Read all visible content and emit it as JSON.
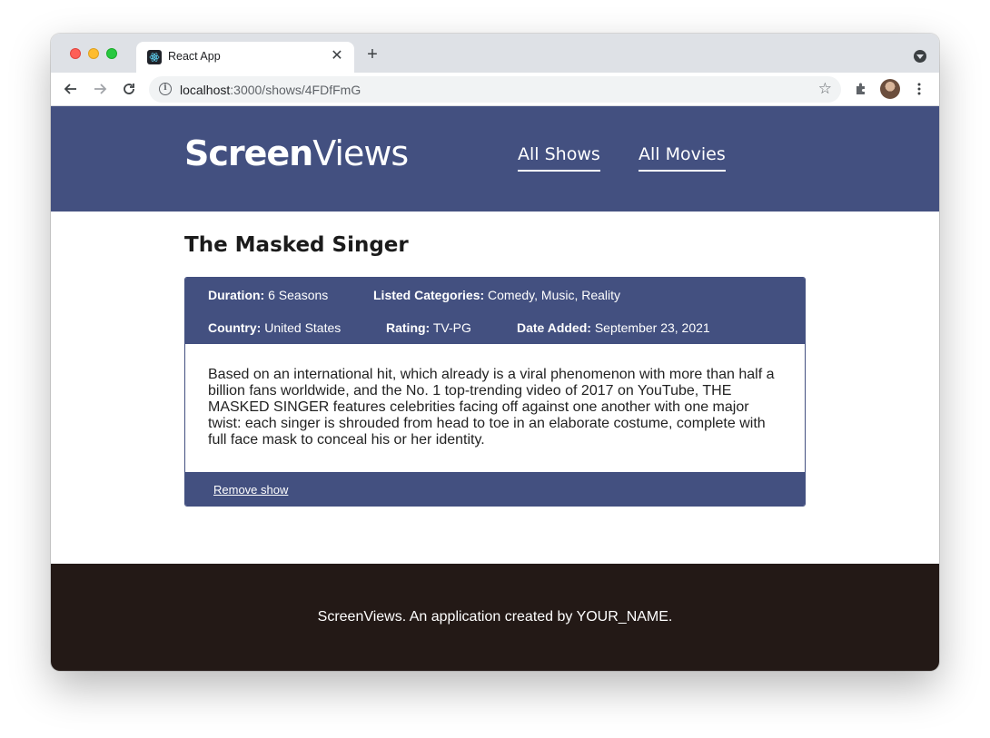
{
  "browser": {
    "tab_title": "React App",
    "tab_close": "✕",
    "new_tab": "+",
    "url_host": "localhost",
    "url_rest": ":3000/shows/4FDfFmG"
  },
  "header": {
    "logo_bold": "Screen",
    "logo_light": "Views",
    "nav": [
      {
        "label": "All Shows"
      },
      {
        "label": "All Movies"
      }
    ]
  },
  "show": {
    "title": "The Masked Singer",
    "duration_label": "Duration:",
    "duration": "6 Seasons",
    "categories_label": "Listed Categories:",
    "categories": "Comedy, Music, Reality",
    "country_label": "Country:",
    "country": "United States",
    "rating_label": "Rating:",
    "rating": "TV-PG",
    "date_label": "Date Added:",
    "date_added": "September 23, 2021",
    "description": "Based on an international hit, which already is a viral phenomenon with more than half a billion fans worldwide, and the No. 1 top-trending video of 2017 on YouTube, THE MASKED SINGER features celebrities facing off against one another with one major twist: each singer is shrouded from head to toe in an elaborate costume, complete with full face mask to conceal his or her identity.",
    "remove_label": "Remove show"
  },
  "footer": {
    "text": "ScreenViews. An application created by YOUR_NAME."
  },
  "colors": {
    "brand": "#435080",
    "footer_bg": "#231916"
  }
}
